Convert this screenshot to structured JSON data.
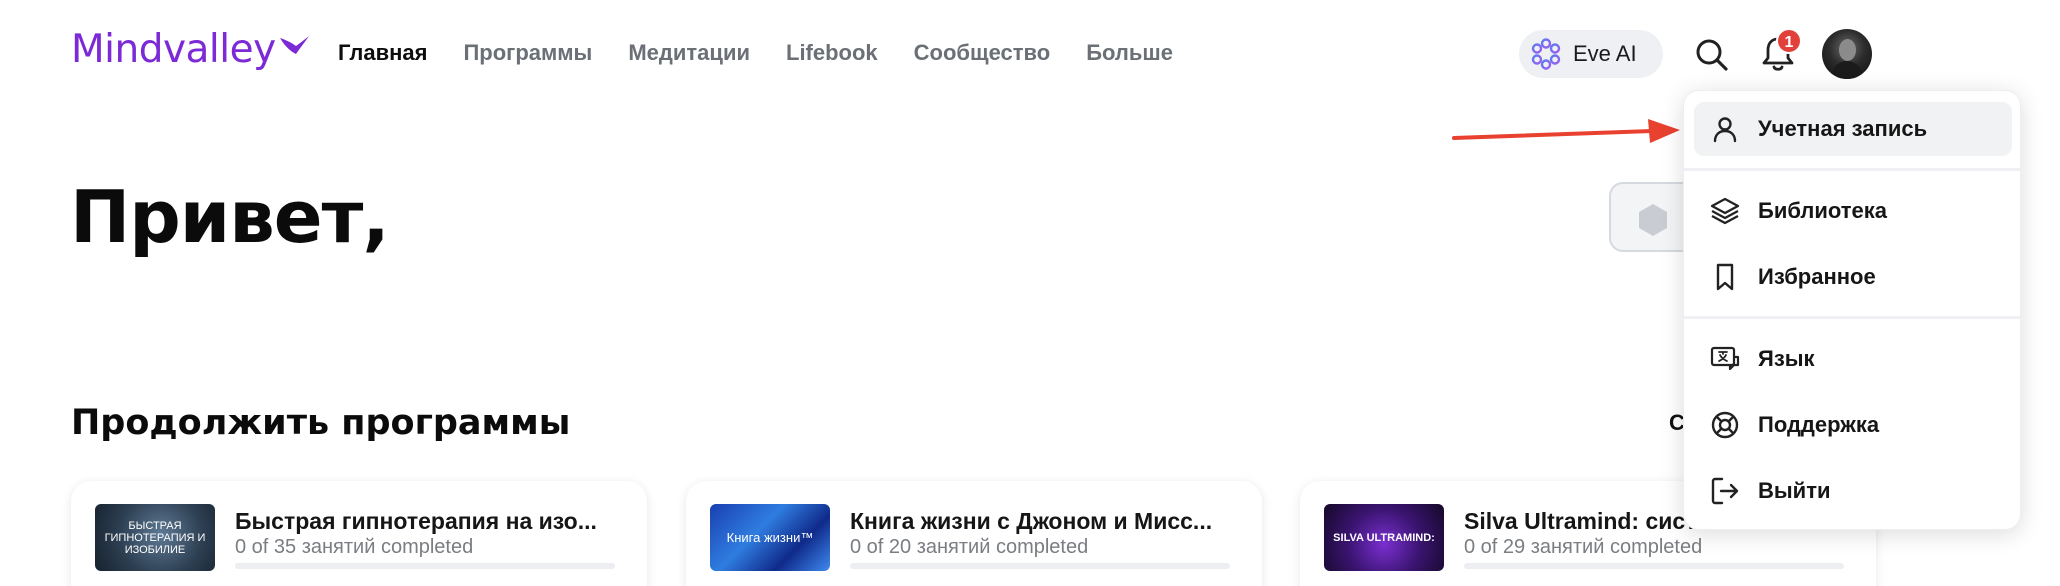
{
  "header": {
    "logo_text": "Mindvalley",
    "nav": [
      "Главная",
      "Программы",
      "Медитации",
      "Lifebook",
      "Сообщество",
      "Больше"
    ],
    "active_nav": 0,
    "eve_label": "Eve AI",
    "notification_count": "1",
    "icons": {
      "search": "search-icon",
      "bell": "bell-icon",
      "eve": "eve-ai-icon"
    }
  },
  "hero": {
    "greeting": "Привет,"
  },
  "continue_section": {
    "title": "Продолжить программы",
    "link_text": "С",
    "cards": [
      {
        "title": "Быстрая гипнотерапия на изо...",
        "progress_text": "0 of 35 занятий completed",
        "progress": 0,
        "thumb_text": "БЫСТРАЯ ГИПНОТЕРАПИЯ И ИЗОБИЛИЕ"
      },
      {
        "title": "Книга жизни с Джоном и Мисс...",
        "progress_text": "0 of 20 занятий completed",
        "progress": 0,
        "thumb_text": "Книга жизни™"
      },
      {
        "title": "Silva Ultramind: сист",
        "progress_text": "0 of 29 занятий completed",
        "progress": 0,
        "thumb_text": "SILVA ULTRAMIND:"
      }
    ]
  },
  "account_menu": {
    "items": [
      {
        "label": "Учетная запись",
        "icon": "user-icon"
      },
      {
        "label": "Библиотека",
        "icon": "layers-icon"
      },
      {
        "label": "Избранное",
        "icon": "bookmark-icon"
      },
      {
        "label": "Язык",
        "icon": "translate-icon"
      },
      {
        "label": "Поддержка",
        "icon": "lifebuoy-icon"
      },
      {
        "label": "Выйти",
        "icon": "logout-icon"
      }
    ],
    "highlighted": 0
  },
  "colors": {
    "brand": "#7b2ad6",
    "badge": "#e2413b",
    "annotation_arrow": "#e8412f"
  }
}
